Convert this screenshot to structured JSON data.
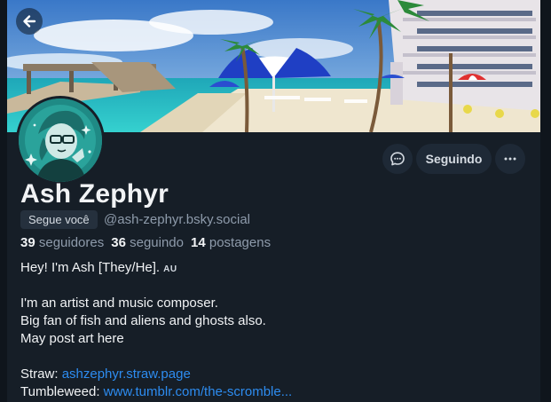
{
  "profile": {
    "display_name": "Ash Zephyr",
    "follows_you": "Segue você",
    "handle": "@ash-zephyr.bsky.social",
    "stats": {
      "followers_count": "39",
      "followers_label": "seguidores",
      "following_count": "36",
      "following_label": "seguindo",
      "posts_count": "14",
      "posts_label": "postagens"
    }
  },
  "actions": {
    "follow_label": "Seguindo"
  },
  "bio": {
    "line1": "Hey! I'm Ash [They/He].",
    "line1_tag": "AU",
    "line2": "I'm an artist and music composer.",
    "line3": "Big fan of fish and aliens and ghosts also.",
    "line4": "May post art here",
    "straw_label": "Straw:",
    "straw_link": "ashzephyr.straw.page",
    "tumbleweed_label": "Tumbleweed:",
    "tumbleweed_link": "www.tumblr.com/the-scromble..."
  },
  "icons": {
    "back": "arrow-left-icon",
    "message": "chat-bubble-icon",
    "more": "ellipsis-icon"
  },
  "colors": {
    "background": "#161e27",
    "button_bg": "#1e2936",
    "link": "#2d8cf0",
    "muted_text": "#8e9bab"
  }
}
